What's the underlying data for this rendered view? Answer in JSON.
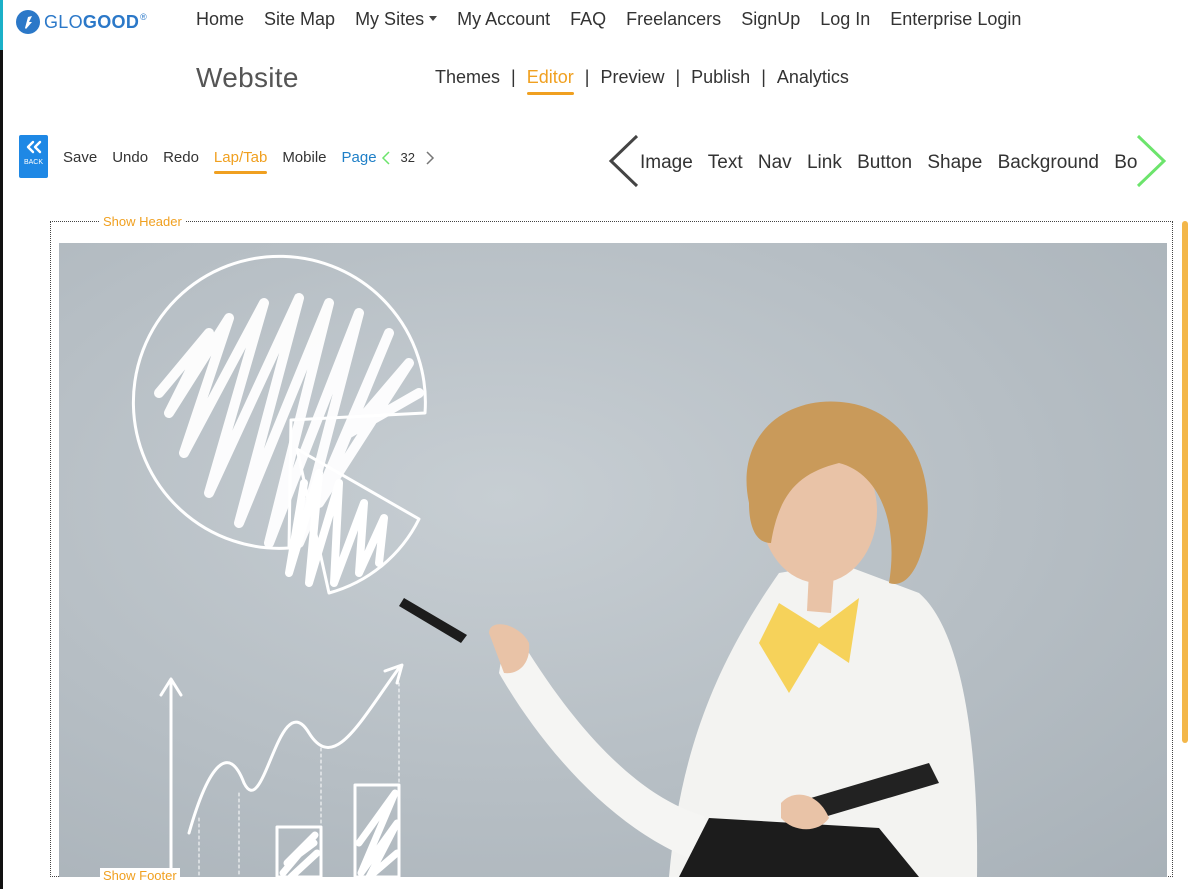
{
  "brand": {
    "name_part1": "GLO",
    "name_part2": "GOOD",
    "reg": "®"
  },
  "topnav": {
    "items": [
      "Home",
      "Site Map",
      "My Sites",
      "My Account",
      "FAQ",
      "Freelancers",
      "SignUp",
      "Log In",
      "Enterprise Login"
    ]
  },
  "site": {
    "title": "Website"
  },
  "subnav": {
    "items": [
      "Themes",
      "Editor",
      "Preview",
      "Publish",
      "Analytics"
    ],
    "active": "Editor",
    "separator": "|"
  },
  "toolbar": {
    "back_label": "BACK",
    "save": "Save",
    "undo": "Undo",
    "redo": "Redo",
    "laptab": "Lap/Tab",
    "mobile": "Mobile",
    "page": "Page",
    "page_number": "32"
  },
  "elements": {
    "items": [
      "Image",
      "Text",
      "Nav",
      "Link",
      "Button",
      "Shape",
      "Background",
      "Border"
    ]
  },
  "canvas": {
    "show_header": "Show Header",
    "show_footer": "Show Footer"
  },
  "colors": {
    "accent": "#f0a020",
    "brand_blue": "#1e88e5",
    "page_link": "#1e7fc7",
    "next_arrow": "#6ce46c"
  },
  "icons": {
    "back": "double-chevron-left-icon",
    "prev_page": "chevron-left-icon",
    "next_page": "chevron-right-icon"
  }
}
